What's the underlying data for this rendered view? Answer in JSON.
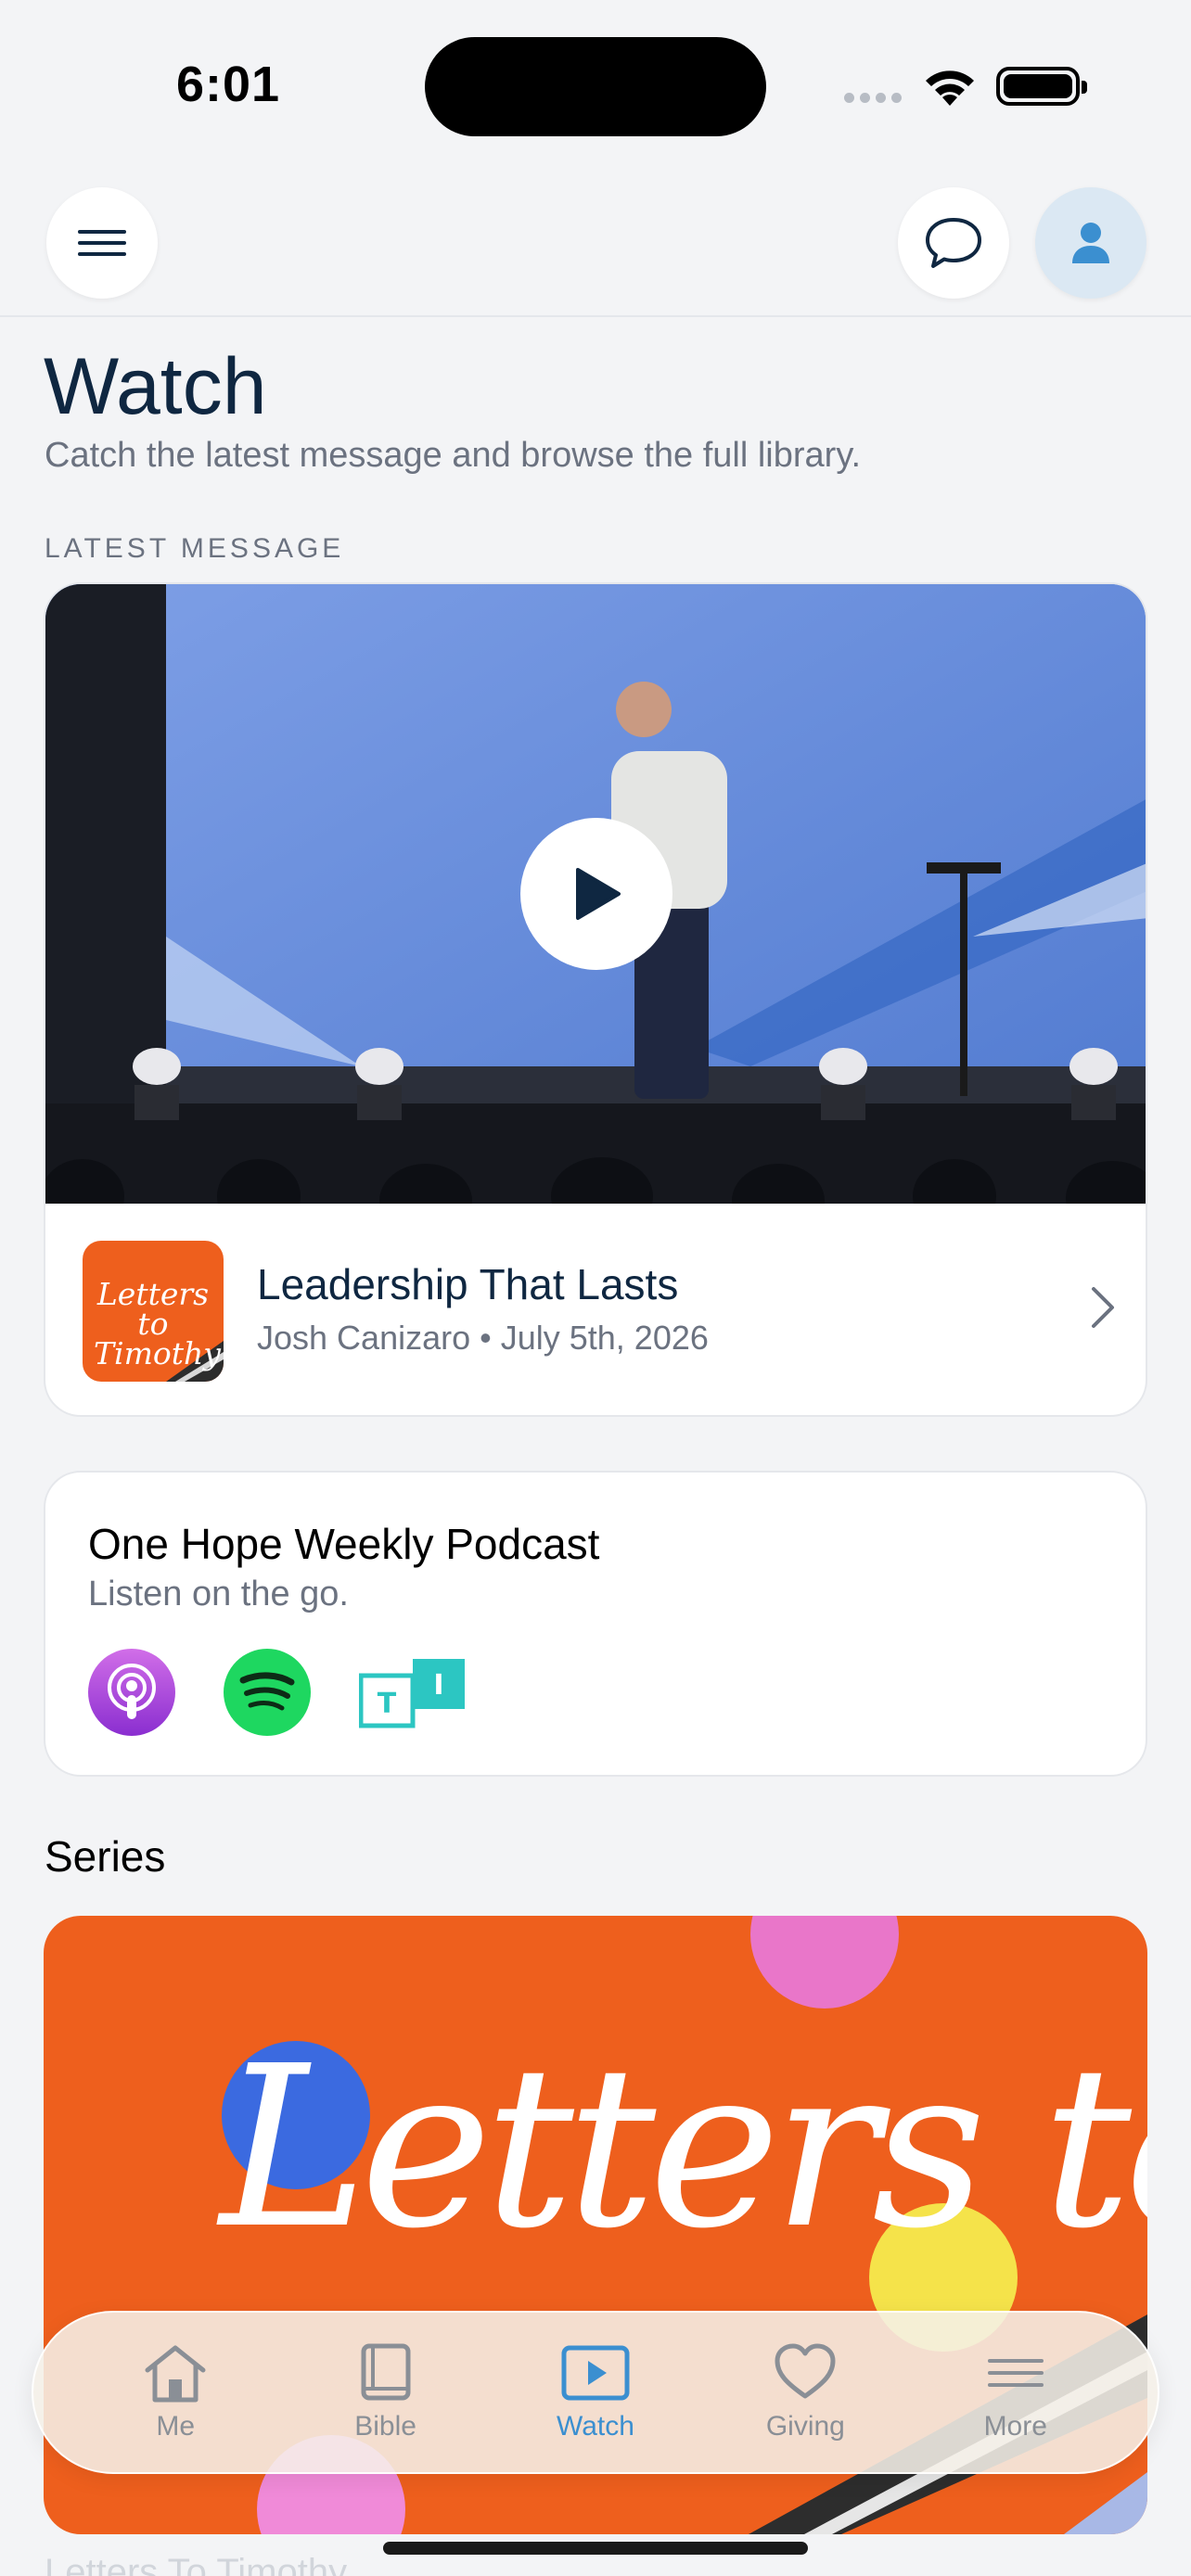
{
  "status_bar": {
    "time": "6:01"
  },
  "header": {
    "title": "Watch",
    "subtitle": "Catch the latest message and browse the full library."
  },
  "latest": {
    "section_label": "LATEST MESSAGE",
    "series_thumb_text": "Letters to Timothy",
    "title": "Leadership That Lasts",
    "meta": "Josh Canizaro • July 5th, 2026"
  },
  "podcast": {
    "title": "One Hope Weekly Podcast",
    "subtitle": "Listen on the go.",
    "platforms": [
      "apple-podcasts-icon",
      "spotify-icon",
      "tiktok-podcast-icon"
    ]
  },
  "series": {
    "heading": "Series",
    "art_text": "Letters to Timothy",
    "below_text": "Letters To Timothy"
  },
  "tabbar": {
    "items": [
      {
        "label": "Me",
        "icon": "home-icon"
      },
      {
        "label": "Bible",
        "icon": "book-icon"
      },
      {
        "label": "Watch",
        "icon": "play-icon"
      },
      {
        "label": "Giving",
        "icon": "heart-icon"
      },
      {
        "label": "More",
        "icon": "menu-icon"
      }
    ],
    "active": "Watch"
  },
  "colors": {
    "brand_orange": "#ee5f1d",
    "accent_blue": "#3b8fd0",
    "navy": "#0f2741"
  }
}
